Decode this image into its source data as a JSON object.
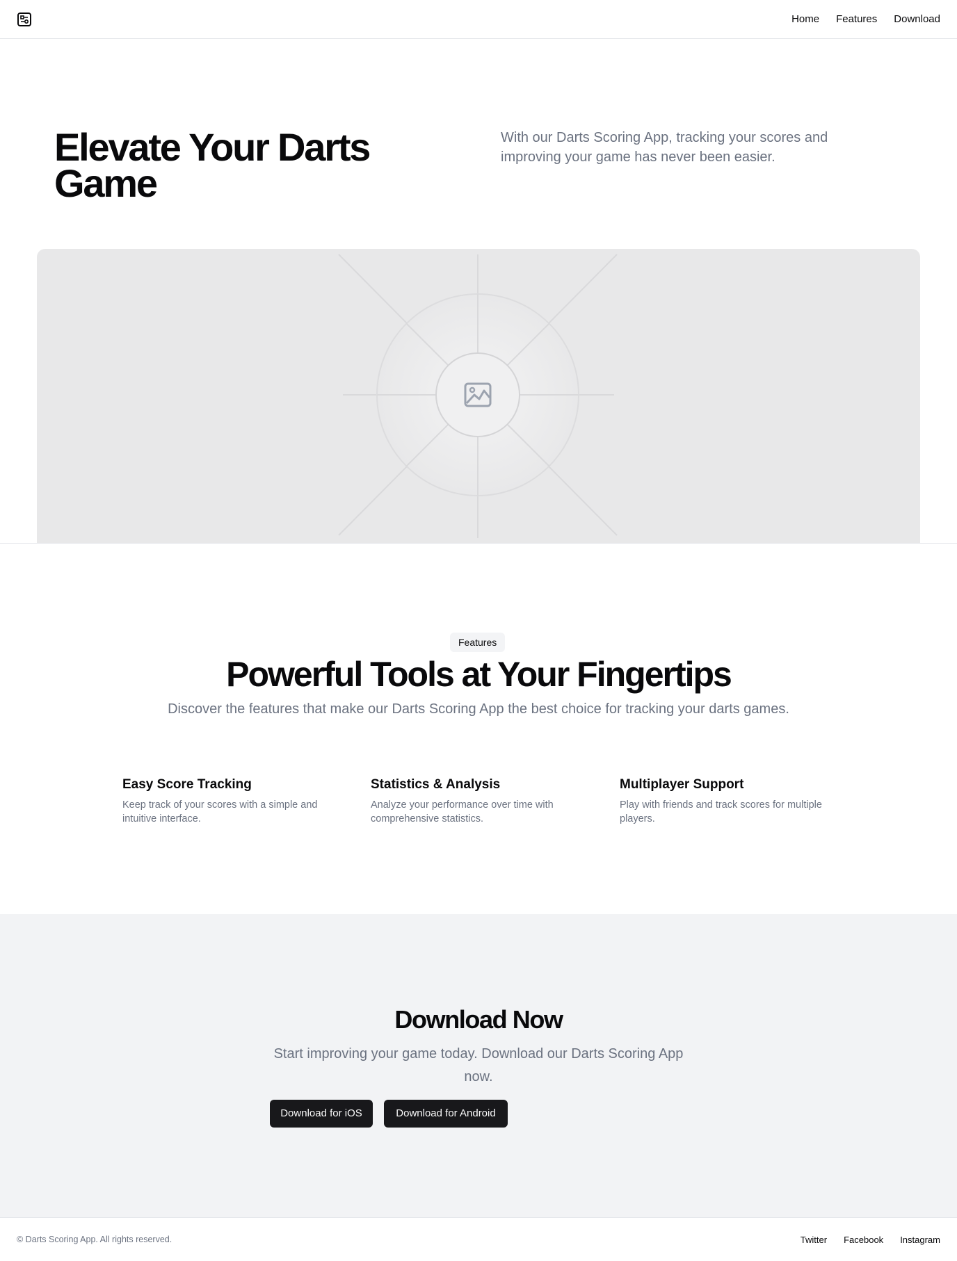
{
  "header": {
    "logo_icon": "app-logo-icon",
    "nav": [
      {
        "label": "Home"
      },
      {
        "label": "Features"
      },
      {
        "label": "Download"
      }
    ]
  },
  "hero": {
    "title": "Elevate Your Darts Game",
    "description": "With our Darts Scoring App, tracking your scores and improving your game has never been easier.",
    "image_icon": "image-placeholder-icon"
  },
  "features": {
    "badge": "Features",
    "title": "Powerful Tools at Your Fingertips",
    "description": "Discover the features that make our Darts Scoring App the best choice for tracking your darts games.",
    "items": [
      {
        "title": "Easy Score Tracking",
        "text": "Keep track of your scores with a simple and intuitive interface."
      },
      {
        "title": "Statistics & Analysis",
        "text": "Analyze your performance over time with comprehensive statistics."
      },
      {
        "title": "Multiplayer Support",
        "text": "Play with friends and track scores for multiple players."
      }
    ]
  },
  "download": {
    "title": "Download Now",
    "description": "Start improving your game today. Download our Darts Scoring App now.",
    "ios_label": "Download for iOS",
    "android_label": "Download for Android"
  },
  "footer": {
    "copyright": "© Darts Scoring App. All rights reserved.",
    "links": [
      {
        "label": "Twitter"
      },
      {
        "label": "Facebook"
      },
      {
        "label": "Instagram"
      }
    ]
  },
  "colors": {
    "text_primary": "#09090b",
    "text_muted": "#6b7280",
    "button_bg": "#18181b",
    "section_bg": "#f2f3f5",
    "placeholder_bg": "#e8e8e9"
  }
}
